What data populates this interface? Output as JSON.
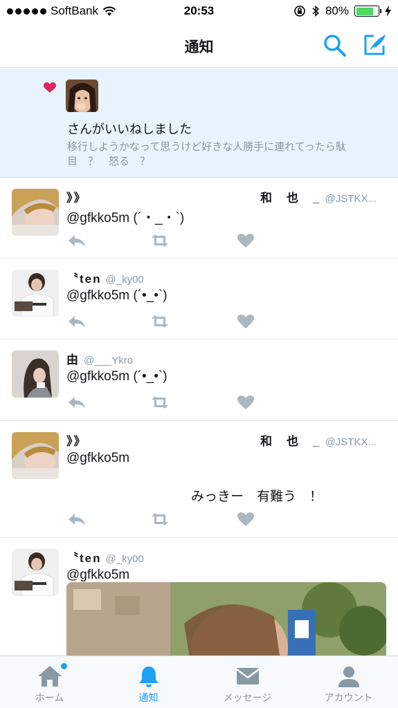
{
  "status_bar": {
    "carrier": "SoftBank",
    "time": "20:53",
    "battery": "80%",
    "battery_level": 0.8
  },
  "nav": {
    "title": "通知"
  },
  "like_notification": {
    "text": "さんがいいねしました",
    "quote": "移行しようかなって思うけど好きな人勝手に連れてったら駄目　？　怒る　？"
  },
  "tweets": [
    {
      "name_left": "》》",
      "name_right": "和　也　_",
      "handle": "@JSTKX...",
      "body": "@gfkko5m (´・_・`)"
    },
    {
      "name": "〝ten",
      "handle": "@_ky00",
      "body": "@gfkko5m (´•_•`)"
    },
    {
      "name": "由",
      "handle": "@___Ykro",
      "body": "@gfkko5m (´•_•`)"
    },
    {
      "name_left": "》》",
      "name_right": "和　也　_",
      "handle": "@JSTKX...",
      "body": "@gfkko5m",
      "body2": "みっきー　有難う　！"
    },
    {
      "name": "〝ten",
      "handle": "@_ky00",
      "body": "@gfkko5m"
    }
  ],
  "tabs": [
    {
      "label": "ホーム",
      "icon": "home-icon"
    },
    {
      "label": "通知",
      "icon": "bell-icon"
    },
    {
      "label": "メッセージ",
      "icon": "envelope-icon"
    },
    {
      "label": "アカウント",
      "icon": "person-icon"
    }
  ],
  "colors": {
    "accent": "#1da1f2",
    "like_red": "#e0245e",
    "highlight_bg": "#e8f4fd"
  }
}
